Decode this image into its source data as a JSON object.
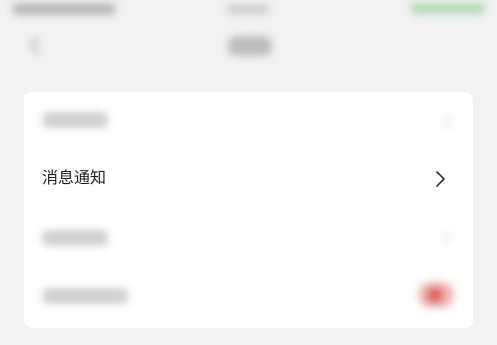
{
  "notifications_row": {
    "label": "消息通知"
  },
  "icons": {
    "back": "chevron-left-icon",
    "row_chevron": "chevron-right-icon"
  },
  "colors": {
    "background": "#f2f2f2",
    "card": "#ffffff",
    "text": "#1f1f1f",
    "toggle_on": "#e05a52",
    "status_right": "#b6d9b9"
  }
}
